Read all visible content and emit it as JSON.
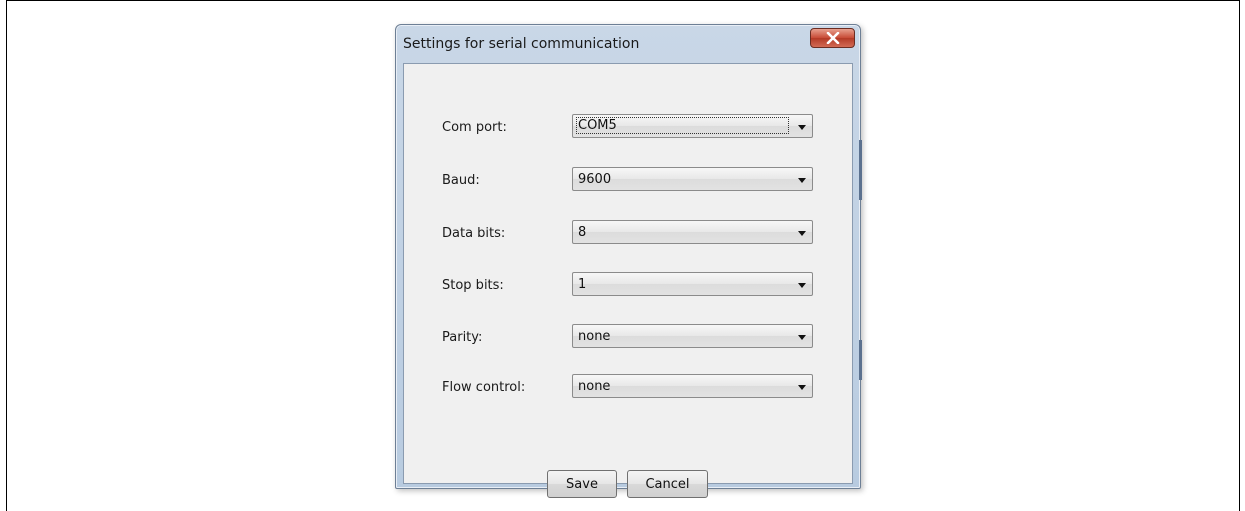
{
  "dialog": {
    "title": "Settings for serial communication",
    "close_label": "close"
  },
  "fields": [
    {
      "label": "Com port:",
      "value": "COM5"
    },
    {
      "label": "Baud:",
      "value": "9600"
    },
    {
      "label": "Data bits:",
      "value": "8"
    },
    {
      "label": "Stop bits:",
      "value": "1"
    },
    {
      "label": "Parity:",
      "value": "none"
    },
    {
      "label": "Flow control:",
      "value": "none"
    }
  ],
  "buttons": {
    "save": "Save",
    "cancel": "Cancel"
  },
  "icons": {
    "close": "close-icon",
    "dropdown": "chevron-down-icon"
  },
  "colors": {
    "close_button": "#c74a35",
    "dialog_frame": "#b8cbe0",
    "client_background": "#f0f0f0"
  }
}
